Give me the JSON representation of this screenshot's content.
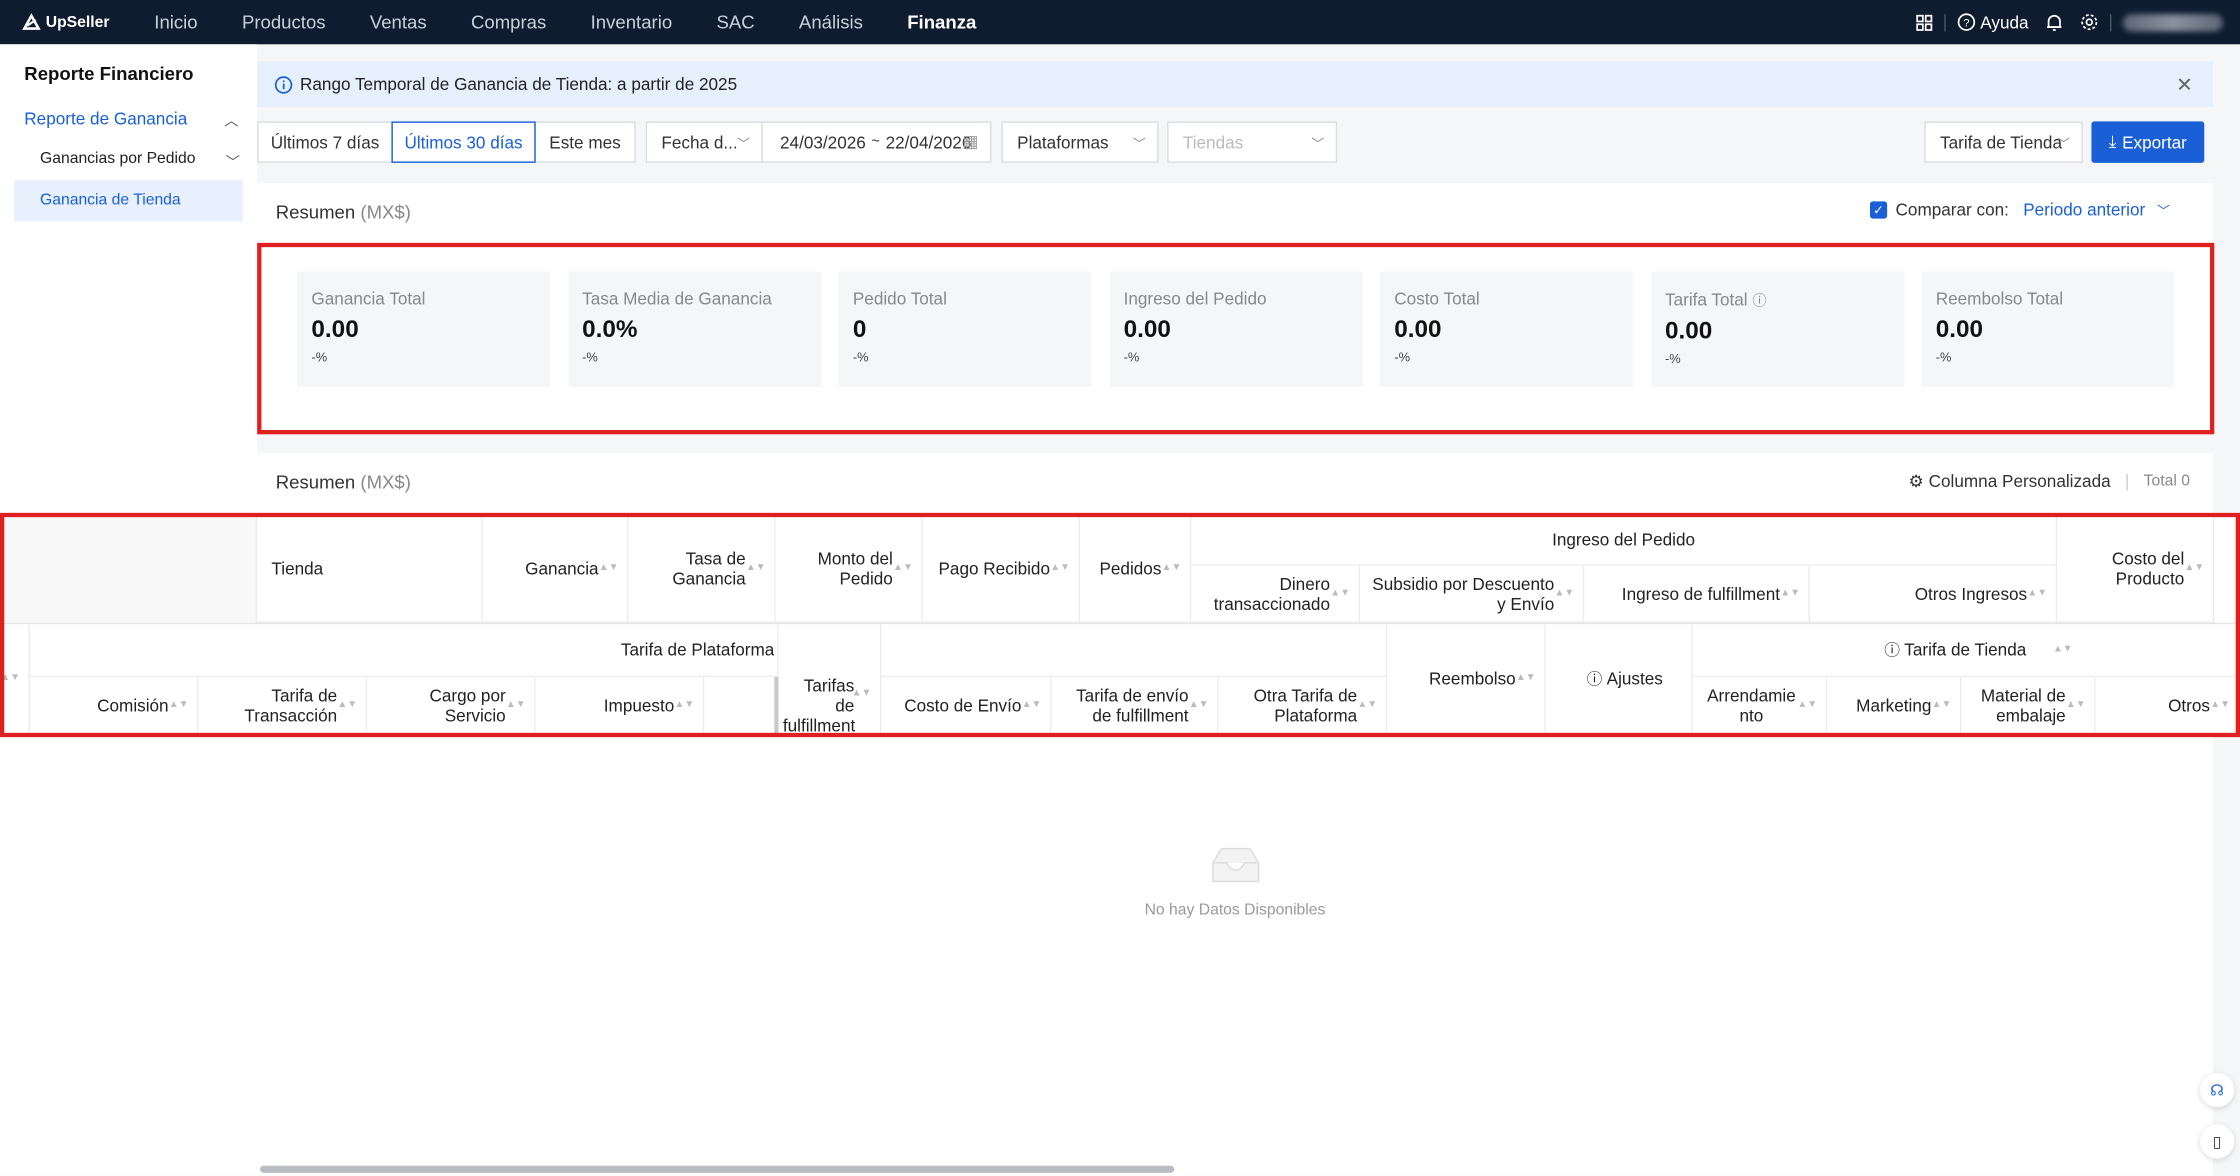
{
  "app": {
    "name": "UpSeller"
  },
  "nav": {
    "items": [
      "Inicio",
      "Productos",
      "Ventas",
      "Compras",
      "Inventario",
      "SAC",
      "Análisis",
      "Finanza"
    ],
    "active": "Finanza"
  },
  "topbar": {
    "help": "Ayuda"
  },
  "sidebar": {
    "title": "Reporte Financiero",
    "group": "Reporte de Ganancia",
    "sub": "Ganancias por Pedido",
    "active": "Ganancia de Tienda"
  },
  "banner": {
    "text": "Rango Temporal de Ganancia de Tienda: a partir de 2025"
  },
  "filters": {
    "last7": "Últimos 7 días",
    "last30": "Últimos 30 días",
    "month": "Este mes",
    "date_type": "Fecha d...",
    "date_start": "24/03/2026",
    "date_sep": "~",
    "date_end": "22/04/2026",
    "platforms": "Plataformas",
    "stores_placeholder": "Tiendas",
    "fee": "Tarifa de Tienda",
    "export": "Exportar"
  },
  "summary": {
    "title": "Resumen",
    "unit": "(MX$)",
    "compare_label": "Comparar con:",
    "compare_value": "Periodo anterior",
    "metrics": [
      {
        "label": "Ganancia Total",
        "value": "0.00",
        "pct": "-%"
      },
      {
        "label": "Tasa Media de Ganancia",
        "value": "0.0%",
        "pct": "-%"
      },
      {
        "label": "Pedido Total",
        "value": "0",
        "pct": "-%"
      },
      {
        "label": "Ingreso del Pedido",
        "value": "0.00",
        "pct": "-%"
      },
      {
        "label": "Costo Total",
        "value": "0.00",
        "pct": "-%"
      },
      {
        "label": "Tarifa Total",
        "value": "0.00",
        "pct": "-%"
      },
      {
        "label": "Reembolso Total",
        "value": "0.00",
        "pct": "-%"
      }
    ]
  },
  "table": {
    "title": "Resumen",
    "unit": "(MX$)",
    "custom_columns": "Columna Personalizada",
    "total": "Total 0",
    "h": {
      "tienda": "Tienda",
      "ganancia": "Ganancia",
      "tasa": "Tasa de Ganancia",
      "monto": "Monto del Pedido",
      "pago": "Pago Recibido",
      "pedidos": "Pedidos",
      "ingreso_group": "Ingreso del Pedido",
      "dinero": "Dinero transaccionado",
      "subsidio": "Subsidio por Descuento y Envío",
      "ingreso_ful": "Ingreso de fulfillment",
      "otros_ing": "Otros Ingresos",
      "costo_prod": "Costo del Producto",
      "plataforma_group": "Tarifa de Plataforma",
      "comision": "Comisión",
      "tarifa_trans": "Tarifa de Transacción",
      "cargo": "Cargo por Servicio",
      "impuesto": "Impuesto",
      "tarifas_ful": "Tarifas de fulfillment",
      "costo_envio": "Costo de Envío",
      "tarifa_envio_ful": "Tarifa de envío de fulfillment",
      "otra_tarifa": "Otra Tarifa de Plataforma",
      "reembolso": "Reembolso",
      "ajustes": "Ajustes",
      "tienda_group": "Tarifa de Tienda",
      "arrend": "Arrendamiento",
      "marketing": "Marketing",
      "material": "Material de embalaje",
      "otros": "Otros"
    },
    "empty": "No hay Datos Disponibles"
  }
}
